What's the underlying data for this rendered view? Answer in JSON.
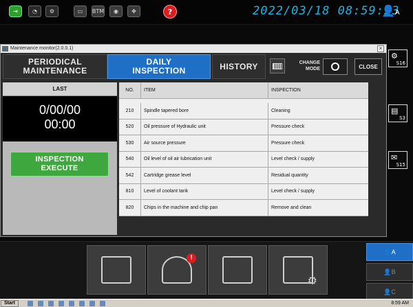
{
  "header": {
    "datetime": "2022/03/18  08:59:23",
    "user": "A",
    "toolbar": [
      {
        "icon": "exit-icon",
        "label": ""
      },
      {
        "icon": "gauge-icon",
        "label": ""
      },
      {
        "icon": "spindle-icon",
        "label": ""
      },
      {
        "icon": "monitor-icon",
        "label": ""
      },
      {
        "icon": "btm-icon",
        "label": "BTM"
      },
      {
        "icon": "camera-icon",
        "label": ""
      },
      {
        "icon": "resize-icon",
        "label": ""
      },
      {
        "icon": "help-icon",
        "label": "?"
      }
    ]
  },
  "side_icons": [
    {
      "label": "S16"
    },
    {
      "label": "S3"
    },
    {
      "label": "S15"
    }
  ],
  "dialog": {
    "title": "Maintenance monitor(2.0.0.1)",
    "close_x": "×",
    "tabs": {
      "periodic": "PERIODICAL\nMAINTENANCE",
      "daily": "DAILY\nINSPECTION",
      "history": "HISTORY"
    },
    "change_mode": "CHANGE\nMODE",
    "close_label": "CLOSE",
    "last_label": "LAST",
    "last_date": "0/00/00",
    "last_time": "00:00",
    "inspection_button": "INSPECTION\nEXECUTE"
  },
  "table": {
    "headers": {
      "no": "NO.",
      "item": "ITEM",
      "inspection": "INSPECTION"
    },
    "rows": [
      {
        "no": "210",
        "item": "Spindle tapered bore",
        "inspection": "Cleaning"
      },
      {
        "no": "520",
        "item": "Oil pressure of Hydraulic unit",
        "inspection": "Pressure check"
      },
      {
        "no": "530",
        "item": "Air source pressure",
        "inspection": "Pressure check"
      },
      {
        "no": "540",
        "item": "Oil level of oil air lubrication unit",
        "inspection": "Level check / supply"
      },
      {
        "no": "542",
        "item": "Cartridge grease level",
        "inspection": "Residual quantity"
      },
      {
        "no": "810",
        "item": "Level of coolant tank",
        "inspection": "Level check / supply"
      },
      {
        "no": "820",
        "item": "Chips in the machine and chip pan",
        "inspection": "Remove and clean"
      }
    ]
  },
  "bottom": {
    "tiles": [
      "machine-icon",
      "maintenance-alert-icon",
      "monitor-panel-icon",
      "settings-window-icon"
    ],
    "users": [
      "A",
      "B",
      "C"
    ]
  },
  "taskbar": {
    "start": "Start",
    "time": "8:59 AM"
  },
  "colors": {
    "accent": "#1f6fc7",
    "clock": "#19b6e6",
    "execute": "#3ea83e"
  }
}
